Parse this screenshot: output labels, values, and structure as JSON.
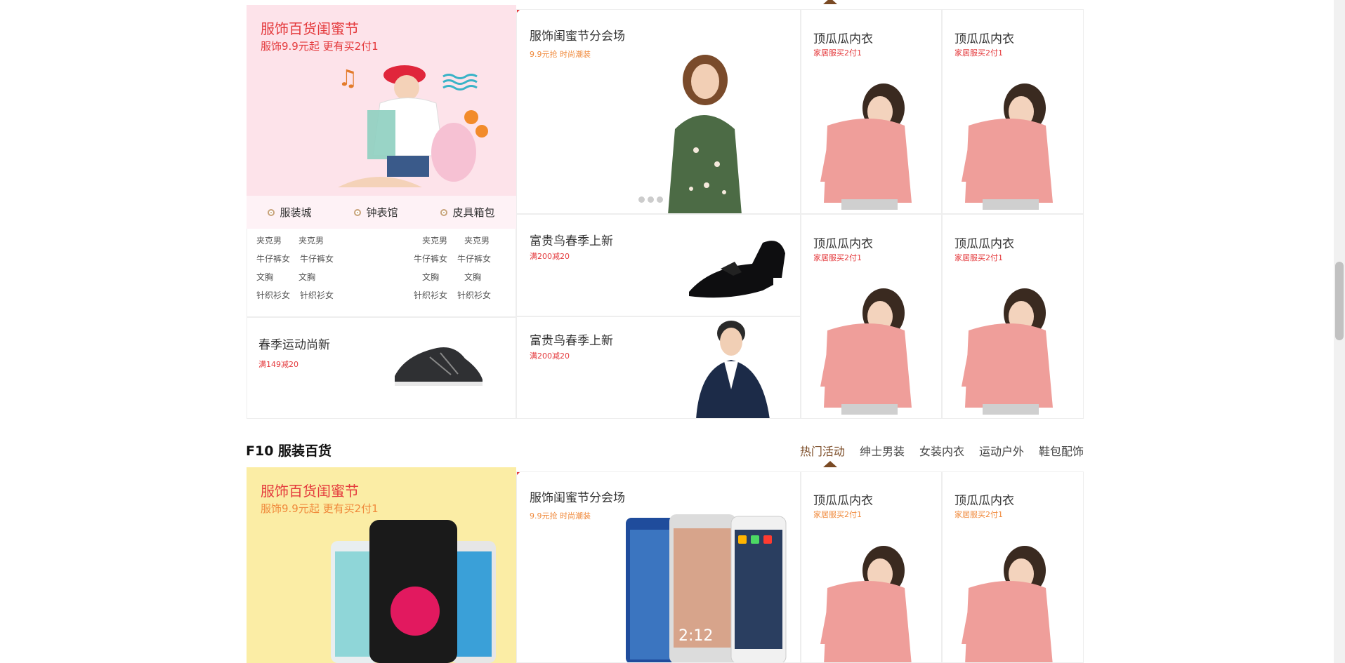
{
  "colors": {
    "accent": "#e4393c",
    "orange": "#f08a3c",
    "tab_arrow": "#7a4a24",
    "pink_bg": "#fde3ea",
    "yellow_bg": "#fbeda5"
  },
  "floor9": {
    "promo": {
      "title": "服饰百货闺蜜节",
      "subtitle": "服饰9.9元起 更有买2付1",
      "quick_links": [
        "服装城",
        "钟表馆",
        "皮具箱包"
      ],
      "cat_col1": [
        "夹克男",
        "牛仔裤女",
        "文胸",
        "针织衫女"
      ],
      "cat_col2": [
        "夹克男",
        "牛仔裤女",
        "文胸",
        "针织衫女"
      ],
      "cat_col3": [
        "夹克男",
        "牛仔裤女",
        "文胸",
        "针织衫女"
      ],
      "cat_col4": [
        "夹克男",
        "牛仔裤女",
        "文胸",
        "针织衫女"
      ]
    },
    "sport": {
      "title": "春季运动尚新",
      "sub": "满149减20"
    },
    "center": {
      "title": "服饰闺蜜节分会场",
      "sub": "9.9元抢 时尚潮装"
    },
    "shoe": {
      "title": "富贵鸟春季上新",
      "sub": "满200减20"
    },
    "men": {
      "title": "富贵鸟春季上新",
      "sub": "满200减20"
    },
    "tiles": [
      {
        "title": "顶瓜瓜内衣",
        "sub": "家居服买2付1"
      },
      {
        "title": "顶瓜瓜内衣",
        "sub": "家居服买2付1"
      },
      {
        "title": "顶瓜瓜内衣",
        "sub": "家居服买2付1"
      },
      {
        "title": "顶瓜瓜内衣",
        "sub": "家居服买2付1"
      }
    ]
  },
  "floor10": {
    "heading": "F10 服装百货",
    "tabs": [
      "热门活动",
      "绅士男装",
      "女装内衣",
      "运动户外",
      "鞋包配饰"
    ],
    "promo": {
      "title": "服饰百货闺蜜节",
      "subtitle": "服饰9.9元起 更有买2付1"
    },
    "center": {
      "title": "服饰闺蜜节分会场",
      "sub": "9.9元抢 时尚潮装",
      "phone_time": "2:12"
    },
    "tiles": [
      {
        "title": "顶瓜瓜内衣",
        "sub": "家居服买2付1"
      },
      {
        "title": "顶瓜瓜内衣",
        "sub": "家居服买2付1"
      }
    ]
  }
}
